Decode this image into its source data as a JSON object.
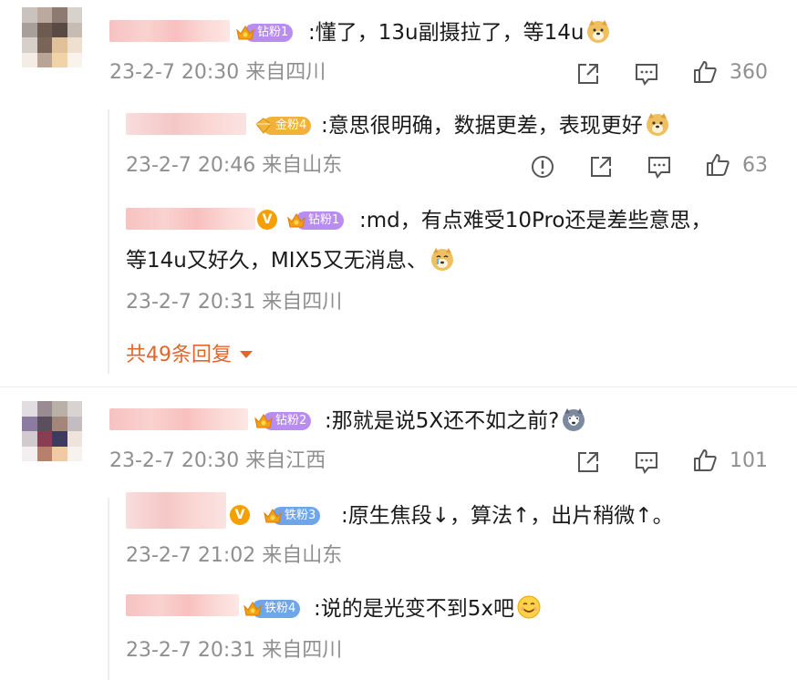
{
  "comments": [
    {
      "badge": "钻粉1",
      "text": ":懂了，13u副摄拉了，等14u",
      "time": "23-2-7 20:30",
      "location": "来自四川",
      "likes": "360"
    },
    {
      "badge": "钻粉2",
      "text": ":那就是说5X还不如之前?",
      "time": "23-2-7 20:30",
      "location": "来自江西",
      "likes": "101"
    }
  ],
  "replies1": [
    {
      "badge": "金粉4",
      "text": ":意思很明确，数据更差，表现更好",
      "time": "23-2-7 20:46",
      "location": "来自山东",
      "likes": "63"
    },
    {
      "badge": "钻粉1",
      "text_line1": ":md，有点难受10Pro还是差些意思，",
      "text_line2": "等14u又好久，MIX5又无消息、",
      "time": "23-2-7 20:31",
      "location": "来自四川"
    }
  ],
  "more_replies": "共49条回复",
  "replies2": [
    {
      "badge": "铁粉3",
      "text": ":原生焦段↓，算法↑，出片稍微↑。",
      "time": "23-2-7 21:02",
      "location": "来自山东"
    },
    {
      "badge": "铁粉4",
      "text": ":说的是光变不到5x吧",
      "time": "23-2-7 20:31",
      "location": "来自四川"
    }
  ],
  "icons": [
    "crown-icon",
    "verified-icon",
    "share-icon",
    "comment-icon",
    "like-icon",
    "report-icon",
    "caret-down-icon"
  ],
  "colors": {
    "diamond_badge": "#b98cf0",
    "gold_badge": "#f2b23a",
    "iron_badge": "#6fa6ea",
    "more_link": "#e0662b",
    "meta_text": "#8f8f8f"
  }
}
